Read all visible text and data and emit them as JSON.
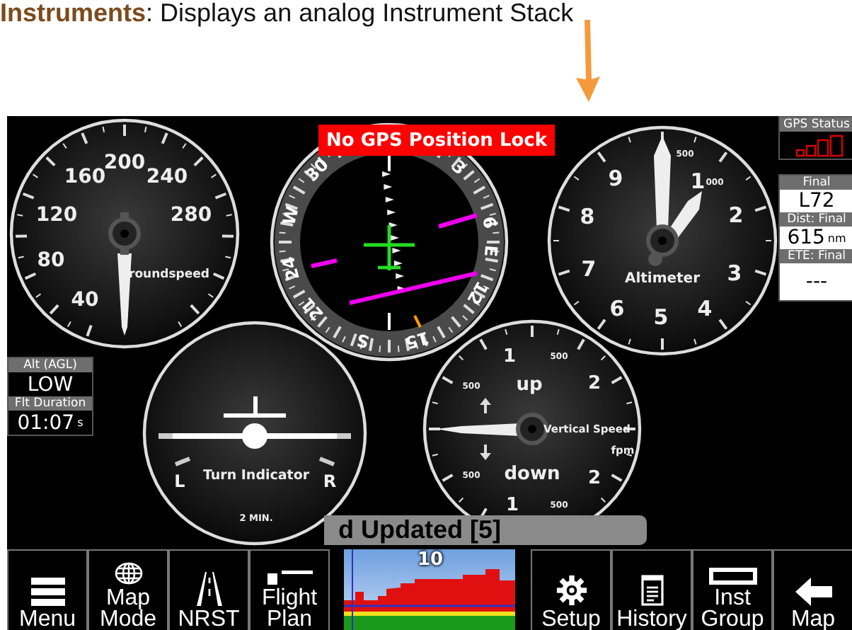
{
  "caption": "**Instruments**: Displays an analog Instrument Stack",
  "alert": "No GPS Position Lock",
  "gauges": [
    {
      "kind": "airspeed",
      "title": "roundspeed",
      "labels": [
        "40",
        "80",
        "120",
        "160",
        "200",
        "240",
        "280"
      ]
    },
    {
      "kind": "heading",
      "labels": [
        "3",
        "6",
        "E",
        "12",
        "15",
        "S",
        "21",
        "24",
        "W",
        "30"
      ]
    },
    {
      "kind": "altimeter",
      "title": "Altimeter",
      "labels": [
        "9",
        "500",
        "1",
        "000",
        "2",
        "3",
        "4",
        "5",
        "6",
        "7",
        "8"
      ]
    },
    {
      "kind": "turn",
      "title": "Turn Indicator",
      "labels": [
        "L",
        "R",
        "2 MIN."
      ]
    },
    {
      "kind": "vsi",
      "title": "Vertical Speed",
      "labels": [
        "1",
        "500",
        "500",
        "up",
        "2",
        "fpm",
        "500",
        "down",
        "2",
        "1",
        "500"
      ]
    }
  ],
  "left_panel": [
    {
      "label": "Alt (AGL)",
      "value": "LOW"
    },
    {
      "label": "Flt Duration",
      "value": "01:07",
      "unit": "s"
    }
  ],
  "right_panel": {
    "gps_status": "GPS Status",
    "fields": [
      {
        "label": "Final",
        "value": "L72"
      },
      {
        "label": "Dist: Final",
        "value": "615",
        "unit": "nm"
      },
      {
        "label": "ETE: Final",
        "value": "---"
      }
    ]
  },
  "status_message": "d Updated [5]",
  "toolbar": {
    "left": [
      "Menu",
      "Map Mode",
      "NRST",
      "Flight Plan"
    ],
    "terrain": {
      "label": "10"
    },
    "right": [
      "Setup",
      "History",
      "Inst Group",
      "Map"
    ]
  }
}
